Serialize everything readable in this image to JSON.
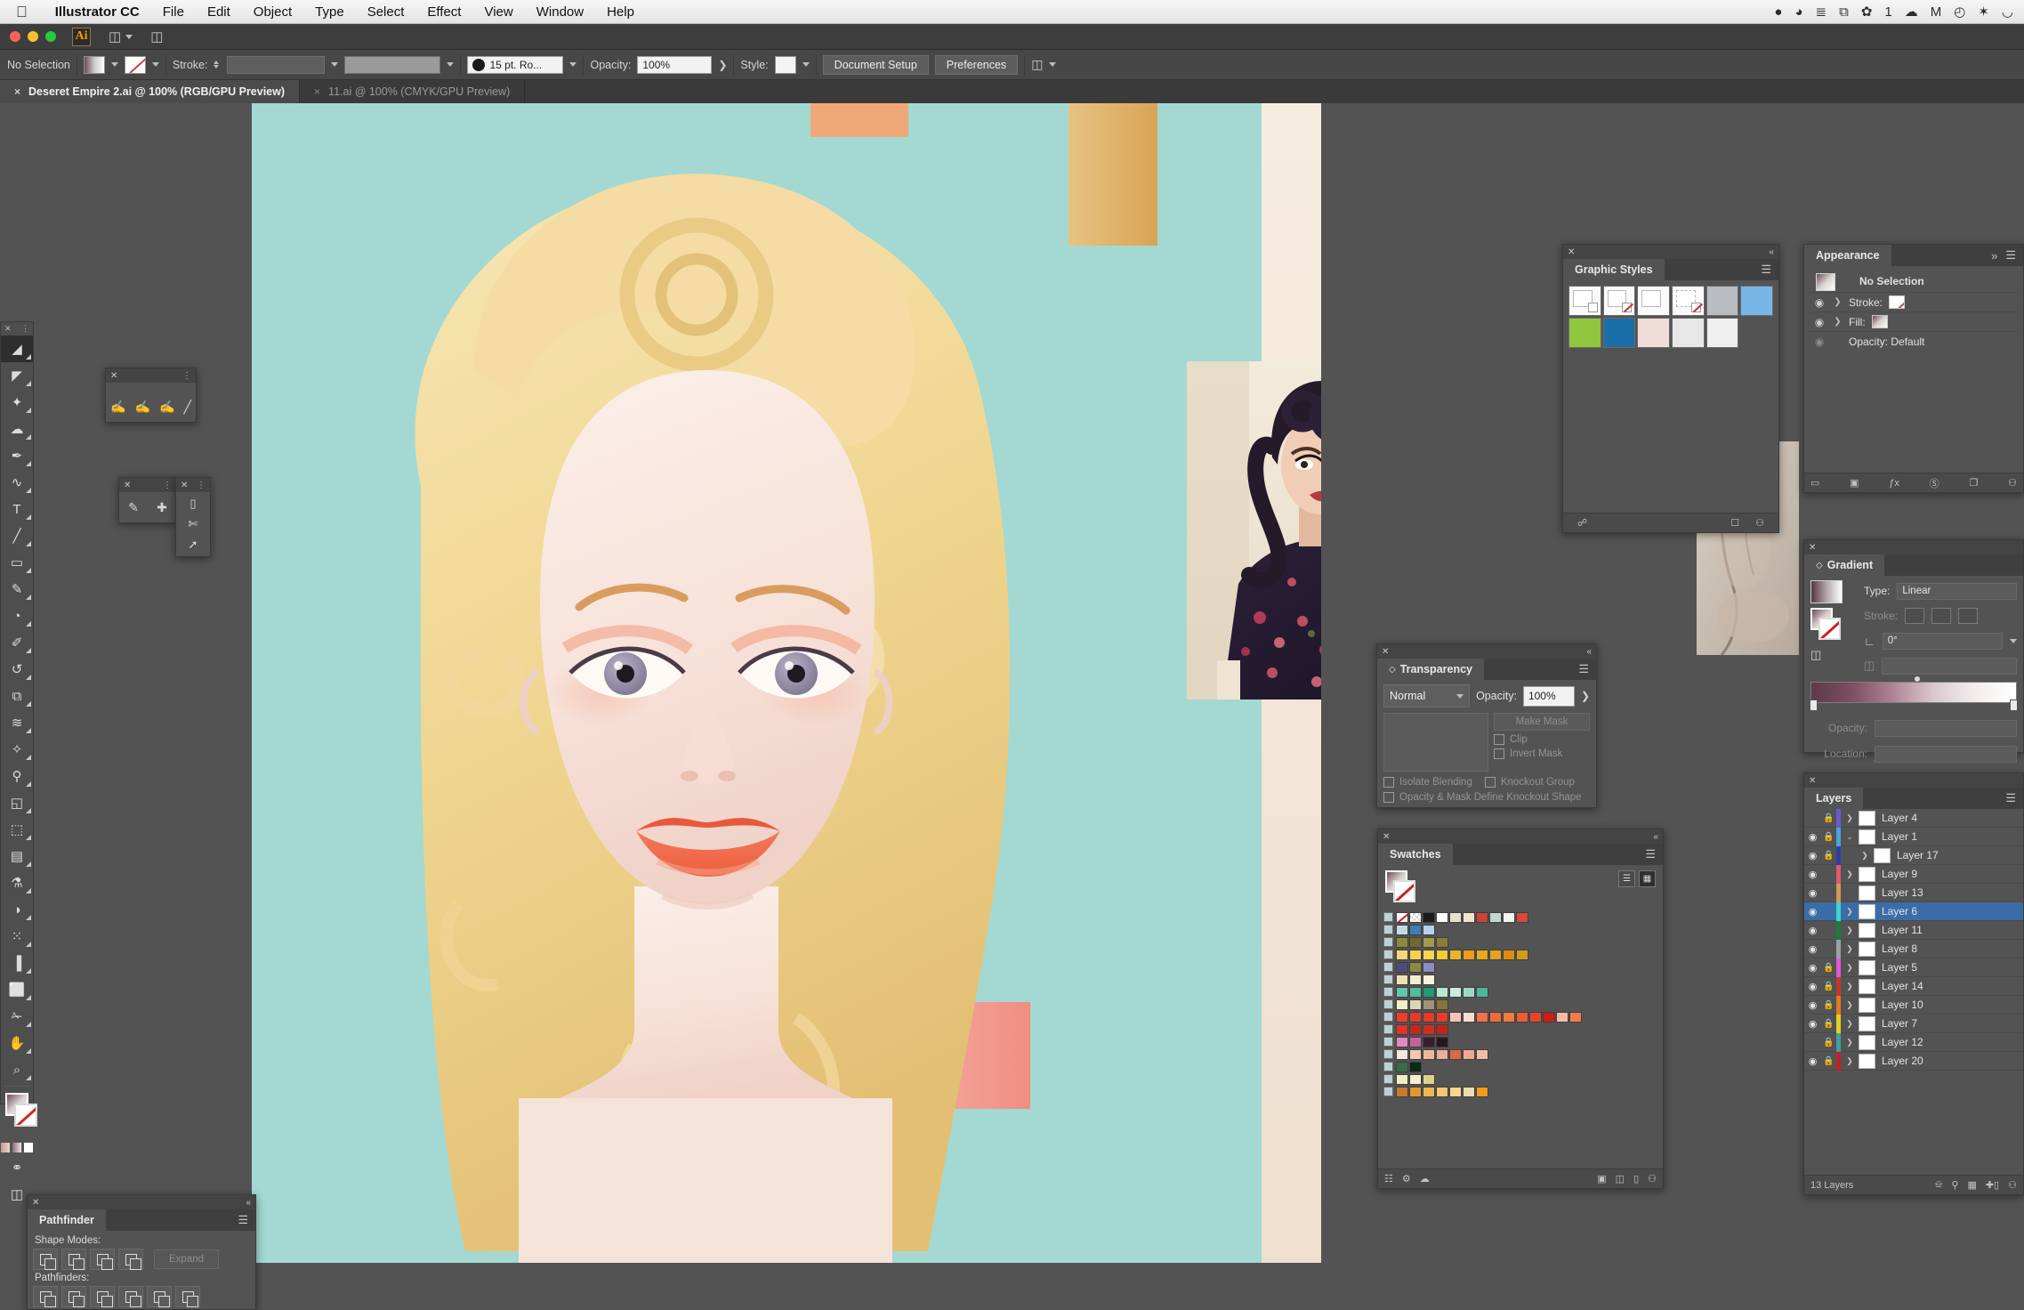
{
  "mac_menubar": {
    "apple_icon": "apple-icon",
    "items": [
      {
        "label": "Illustrator CC",
        "bold": true
      },
      {
        "label": "File"
      },
      {
        "label": "Edit"
      },
      {
        "label": "Object"
      },
      {
        "label": "Type"
      },
      {
        "label": "Select"
      },
      {
        "label": "Effect"
      },
      {
        "label": "View"
      },
      {
        "label": "Window"
      },
      {
        "label": "Help"
      }
    ],
    "status_icons": [
      {
        "name": "qq-penguin-icon",
        "glyph": "●"
      },
      {
        "name": "baidu-cloud-icon",
        "glyph": "◕"
      },
      {
        "name": "input-method-icon",
        "glyph": "≣"
      },
      {
        "name": "screen-capture-icon",
        "glyph": "⧉"
      },
      {
        "name": "wechat-icon",
        "glyph": "✿"
      },
      {
        "name": "notification-count",
        "glyph": "1"
      },
      {
        "name": "dropbox-icon",
        "glyph": "☁"
      },
      {
        "name": "mailbird-icon",
        "glyph": "M"
      },
      {
        "name": "clock-icon",
        "glyph": "◴"
      },
      {
        "name": "bluetooth-icon",
        "glyph": "✶"
      },
      {
        "name": "wifi-icon",
        "glyph": "◡"
      }
    ]
  },
  "appbar": {
    "logo_text": "Ai",
    "arrange_label": "arrange-documents-icon",
    "workspace_label": "workspace-switcher-icon"
  },
  "control_bar": {
    "selection_status": "No Selection",
    "fill_swatch": "gradient-fill-swatch",
    "stroke_swatch": "none-stroke-swatch",
    "stroke_label": "Stroke:",
    "stroke_weight": "",
    "stroke_profile": "",
    "brush_definition": "15 pt. Ro...",
    "opacity_label": "Opacity:",
    "opacity_value": "100%",
    "style_label": "Style:",
    "document_setup_button": "Document Setup",
    "preferences_button": "Preferences",
    "align_icon": "align-objects-icon"
  },
  "tabs": [
    {
      "label": "Deseret Empire 2.ai @ 100% (RGB/GPU Preview)",
      "active": true,
      "close": "×"
    },
    {
      "label": "11.ai @ 100% (CMYK/GPU Preview)",
      "active": false,
      "close": "×"
    }
  ],
  "toolbar": {
    "tools": [
      {
        "name": "selection-tool",
        "glyph": "◢",
        "selected": true
      },
      {
        "name": "direct-selection-tool",
        "glyph": "◤",
        "selected": false
      },
      {
        "name": "magic-wand-tool",
        "glyph": "✦",
        "selected": false
      },
      {
        "name": "lasso-tool",
        "glyph": "☁",
        "selected": false
      },
      {
        "name": "pen-tool",
        "glyph": "✒",
        "selected": false
      },
      {
        "name": "curvature-tool",
        "glyph": "∿",
        "selected": false
      },
      {
        "name": "type-tool",
        "glyph": "T",
        "selected": false
      },
      {
        "name": "line-segment-tool",
        "glyph": "╱",
        "selected": false
      },
      {
        "name": "rectangle-tool",
        "glyph": "▭",
        "selected": false
      },
      {
        "name": "paintbrush-tool",
        "glyph": "✎",
        "selected": false
      },
      {
        "name": "shaper-tool",
        "glyph": "◔",
        "selected": false
      },
      {
        "name": "blob-brush-tool",
        "glyph": "✐",
        "selected": false
      },
      {
        "name": "rotate-tool",
        "glyph": "↺",
        "selected": false
      },
      {
        "name": "scale-tool",
        "glyph": "⧉",
        "selected": false
      },
      {
        "name": "width-tool",
        "glyph": "≋",
        "selected": false
      },
      {
        "name": "free-transform-tool",
        "glyph": "✧",
        "selected": false
      },
      {
        "name": "shape-builder-tool",
        "glyph": "⚲",
        "selected": false
      },
      {
        "name": "perspective-grid-tool",
        "glyph": "◱",
        "selected": false
      },
      {
        "name": "mesh-tool",
        "glyph": "⬚",
        "selected": false
      },
      {
        "name": "gradient-tool",
        "glyph": "▤",
        "selected": false
      },
      {
        "name": "eyedropper-tool",
        "glyph": "⚗",
        "selected": false
      },
      {
        "name": "blend-tool",
        "glyph": "◑",
        "selected": false
      },
      {
        "name": "symbol-sprayer-tool",
        "glyph": "⁙",
        "selected": false
      },
      {
        "name": "column-graph-tool",
        "glyph": "▐",
        "selected": false
      },
      {
        "name": "artboard-tool",
        "glyph": "⬜",
        "selected": false
      },
      {
        "name": "slice-tool",
        "glyph": "✁",
        "selected": false
      },
      {
        "name": "hand-tool",
        "glyph": "✋",
        "selected": false
      },
      {
        "name": "zoom-tool",
        "glyph": "⌕",
        "selected": false
      }
    ],
    "fill_stroke_name": "fill-and-stroke-indicator",
    "color_modes": [
      "color-swatch-mode",
      "gradient-mode",
      "none-mode"
    ],
    "screen_mode": "change-screen-mode-icon",
    "draw_mode": "drawing-modes-icon"
  },
  "tool_subpanels": [
    {
      "name": "lasso-tool-group",
      "tools": [
        "lasso-icon",
        "add-lasso-icon",
        "subtract-lasso-icon",
        "direct-select-icon"
      ]
    },
    {
      "name": "pen-tool-group",
      "tools": [
        "pen-icon",
        "add-anchor-icon"
      ]
    },
    {
      "name": "eraser-tool-group",
      "tools": [
        "eraser-icon",
        "scissors-icon",
        "knife-icon"
      ]
    }
  ],
  "graphic_styles": {
    "title": "Graphic Styles",
    "menu_icon": "panel-menu-icon",
    "close_icon": "close-icon",
    "collapse_icon": "collapse-panel-icon",
    "styles": [
      {
        "name": "style-default",
        "type": "plain",
        "mark": "square"
      },
      {
        "name": "style-none-stroke",
        "type": "plain",
        "mark": "red"
      },
      {
        "name": "style-plain-3",
        "type": "plain",
        "mark": "none"
      },
      {
        "name": "style-dashed",
        "type": "dashed",
        "mark": "red"
      },
      {
        "name": "style-gray-gradient",
        "color": "#b9bcc0"
      },
      {
        "name": "style-blue-gradient",
        "color": "#79b6e8"
      },
      {
        "name": "style-green-swirl",
        "color": "#8fc63d"
      },
      {
        "name": "style-blue-swirl",
        "color": "#1b6fa8"
      },
      {
        "name": "style-pink-light",
        "color": "#f0dcd8"
      },
      {
        "name": "style-gray-light",
        "color": "#e7e7e7"
      },
      {
        "name": "style-white-light",
        "color": "#efefef"
      }
    ],
    "footer_icons": [
      "break-link-icon",
      "new-style-icon",
      "delete-style-icon"
    ]
  },
  "appearance": {
    "title": "Appearance",
    "menu_icon": "panel-menu-icon",
    "expand_icon": "expand-icon",
    "target_label": "No Selection",
    "rows": [
      {
        "label": "Stroke:",
        "swatch": "stroke-none",
        "eye": "◉",
        "chevron": "❯"
      },
      {
        "label": "Fill:",
        "swatch": "fill-gradient",
        "eye": "◉",
        "chevron": "❯"
      },
      {
        "label": "Opacity: Default",
        "swatch": "",
        "eye": "◉",
        "chevron": ""
      }
    ],
    "footer_icons": [
      "add-new-stroke-icon",
      "add-new-fill-icon",
      "add-new-effect-icon",
      "clear-appearance-icon",
      "duplicate-item-icon",
      "delete-item-icon"
    ]
  },
  "gradient": {
    "title": "Gradient",
    "type_label": "Type:",
    "type_value": "Linear",
    "stroke_label": "Stroke:",
    "angle_label": "angle-icon",
    "angle_value": "0°",
    "aspect_label": "aspect-ratio-icon",
    "aspect_value": "",
    "opacity_label": "Opacity:",
    "opacity_value": "",
    "location_label": "Location:",
    "location_value": "",
    "stops": [
      {
        "position": 0,
        "color": "#563946"
      },
      {
        "position": 100,
        "color": "#ffffff"
      }
    ],
    "midpoint": 50
  },
  "layers": {
    "title": "Layers",
    "menu_icon": "panel-menu-icon",
    "count_label": "13 Layers",
    "footer_icons": [
      "make-clipping-mask-icon",
      "release-icon",
      "new-sublayer-icon",
      "new-layer-icon",
      "delete-layer-icon"
    ],
    "rows": [
      {
        "name": "Layer 4",
        "visible": false,
        "locked": true,
        "expandable": true,
        "expanded": false,
        "selected": false,
        "indent": 0,
        "color": "#6a5acd"
      },
      {
        "name": "Layer 1",
        "visible": true,
        "locked": true,
        "expandable": true,
        "expanded": true,
        "selected": false,
        "indent": 0,
        "color": "#4aa3d8"
      },
      {
        "name": "Layer 17",
        "visible": true,
        "locked": true,
        "expandable": true,
        "expanded": false,
        "selected": false,
        "indent": 1,
        "color": "#2f3f9e"
      },
      {
        "name": "Layer 9",
        "visible": true,
        "locked": false,
        "expandable": true,
        "expanded": false,
        "selected": false,
        "indent": 0,
        "color": "#e05a6e"
      },
      {
        "name": "Layer 13",
        "visible": true,
        "locked": false,
        "expandable": false,
        "expanded": false,
        "selected": false,
        "indent": 0,
        "color": "#d39b52"
      },
      {
        "name": "Layer 6",
        "visible": true,
        "locked": false,
        "expandable": true,
        "expanded": false,
        "selected": true,
        "indent": 0,
        "color": "#3ad6c8"
      },
      {
        "name": "Layer 11",
        "visible": true,
        "locked": false,
        "expandable": true,
        "expanded": false,
        "selected": false,
        "indent": 0,
        "color": "#1f7a3d"
      },
      {
        "name": "Layer 8",
        "visible": true,
        "locked": false,
        "expandable": true,
        "expanded": false,
        "selected": false,
        "indent": 0,
        "color": "#9aa0a6"
      },
      {
        "name": "Layer 5",
        "visible": true,
        "locked": true,
        "expandable": true,
        "expanded": false,
        "selected": false,
        "indent": 0,
        "color": "#e05ad6"
      },
      {
        "name": "Layer 14",
        "visible": true,
        "locked": true,
        "expandable": true,
        "expanded": false,
        "selected": false,
        "indent": 0,
        "color": "#c0392b"
      },
      {
        "name": "Layer 10",
        "visible": true,
        "locked": true,
        "expandable": true,
        "expanded": false,
        "selected": false,
        "indent": 0,
        "color": "#e07b1f"
      },
      {
        "name": "Layer 7",
        "visible": true,
        "locked": true,
        "expandable": true,
        "expanded": false,
        "selected": false,
        "indent": 0,
        "color": "#e0d11f"
      },
      {
        "name": "Layer 12",
        "visible": false,
        "locked": true,
        "expandable": true,
        "expanded": false,
        "selected": false,
        "indent": 0,
        "color": "#3ea0a0"
      },
      {
        "name": "Layer 20",
        "visible": true,
        "locked": true,
        "expandable": true,
        "expanded": false,
        "selected": false,
        "indent": 0,
        "color": "#c0202b"
      }
    ]
  },
  "transparency": {
    "title": "Transparency",
    "menu_icon": "panel-menu-icon",
    "blend_mode": "Normal",
    "opacity_label": "Opacity:",
    "opacity_value": "100%",
    "make_mask_button": "Make Mask",
    "clip_label": "Clip",
    "invert_mask_label": "Invert Mask",
    "isolate_blending_label": "Isolate Blending",
    "knockout_group_label": "Knockout Group",
    "knockout_shape_label": "Opacity & Mask Define Knockout Shape"
  },
  "swatches": {
    "title": "Swatches",
    "menu_icon": "panel-menu-icon",
    "view_list_icon": "list-view-icon",
    "view_grid_icon": "grid-view-icon",
    "footer_icons": [
      "swatch-libraries-icon",
      "show-swatch-kinds-icon",
      "swatch-options-icon",
      "new-color-group-icon",
      "new-swatch-icon",
      "delete-swatch-icon"
    ],
    "rows": [
      [
        "none",
        "registration",
        "#1c1c1c",
        "#ffffff",
        "#e6e0cc",
        "#f0e5c8",
        "#c9443a",
        "#c5d6cf",
        "#f4f4f0",
        "#d8463c"
      ],
      [
        "#c8d8e6",
        "#3f7cb8",
        "#b4d2ea"
      ],
      [
        "#8c8a3a",
        "#6e6b28",
        "#a39a4a",
        "#8a7d38"
      ],
      [
        "#f2d878",
        "#f5d24a",
        "#f7d54e",
        "#f3cc2e",
        "#e8b52a",
        "#f09c1c",
        "#e9a81f",
        "#e2a41c",
        "#e08a14",
        "#d39b1a"
      ],
      [
        "#4b4e78",
        "#8c8a42",
        "#8a8cc2"
      ],
      [
        "#f0e0b4",
        "#f5ecd2",
        "#f8f2de"
      ],
      [
        "#63c6ac",
        "#4dbd9c",
        "#1f9c77",
        "#b8e6d4",
        "#c8ece0",
        "#9ed8c4",
        "#4cb89a"
      ],
      [
        "#f2eec8",
        "#ded6b2",
        "#9e9578",
        "#86763c"
      ],
      [
        "#f03c2e",
        "#e8392c",
        "#e63a2a",
        "#ef3a2a",
        "#f6c4b4",
        "#faded2",
        "#f2724e",
        "#ef6a3e",
        "#f07a42",
        "#ed5c32",
        "#e8442c",
        "#cc1f14",
        "#f9bba6",
        "#f37a4a"
      ],
      [
        "#e03228",
        "#c02820",
        "#d02c22",
        "#c42318"
      ],
      [
        "#e08ac4",
        "#c4629e",
        "#3a1e30",
        "#2a1420"
      ],
      [
        "#f8e8de",
        "#f0c8b4",
        "#eeb8a0",
        "#ecae96",
        "#d86a4a",
        "#f2a890",
        "#f4bca6"
      ],
      [
        "#3a6b4a",
        "#0a2a12"
      ],
      [
        "#f2ecc4",
        "#f6f0cc",
        "#ddd08a"
      ],
      [
        "#c87a28",
        "#e29a30",
        "#edb84e",
        "#f2c870",
        "#f6d68e",
        "#f0dcae",
        "#f29c18"
      ]
    ]
  },
  "pathfinder": {
    "title": "Pathfinder",
    "menu_icon": "panel-menu-icon",
    "shape_modes_label": "Shape Modes:",
    "pathfinders_label": "Pathfinders:",
    "expand_button": "Expand",
    "shape_mode_buttons": [
      "unite-icon",
      "minus-front-icon",
      "intersect-icon",
      "exclude-icon"
    ],
    "pathfinder_buttons": [
      "divide-icon",
      "trim-icon",
      "merge-icon",
      "crop-icon",
      "outline-icon",
      "minus-back-icon"
    ]
  },
  "artwork": {
    "description": "vector-portrait-blonde-woman",
    "background_color": "#a3d9d2",
    "skin_color": "#f6e3dc",
    "hair_color": "#f1d79a",
    "lip_color": "#f2714f",
    "accents": [
      {
        "name": "orange-rect-top",
        "color": "#f0a878"
      },
      {
        "name": "gold-rect-right",
        "color": "#e0b871"
      },
      {
        "name": "pink-rect-bottom",
        "color": "#f09a8c"
      },
      {
        "name": "cream-strip",
        "color": "#f3e2d2"
      }
    ],
    "photo_reference": "pinup-photo-dark-hair-floral-dress",
    "photo_secondary": "skin-texture-photo"
  }
}
